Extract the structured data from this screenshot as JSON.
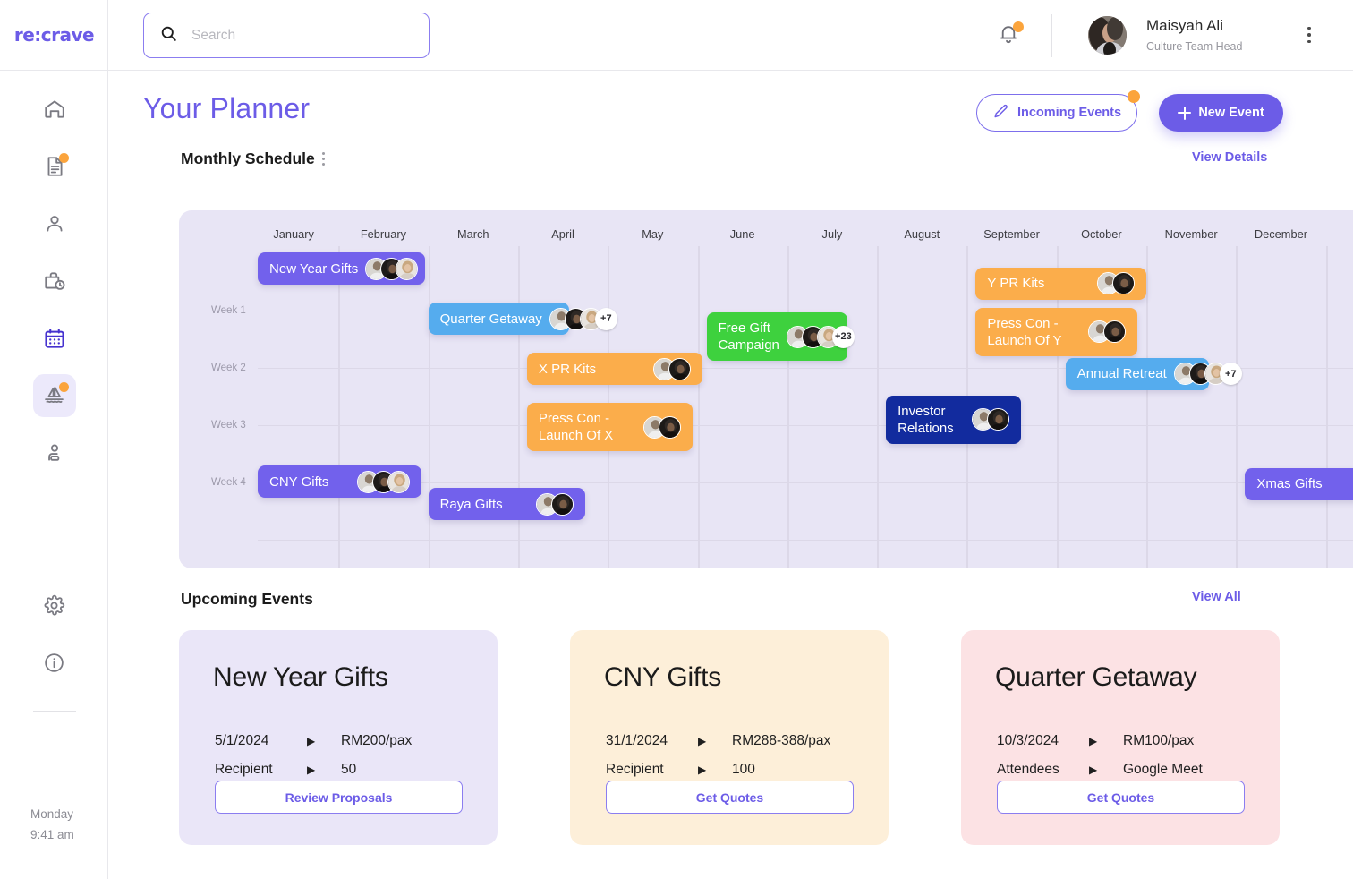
{
  "brand": {
    "logo_text": "re:crave"
  },
  "search": {
    "value": "",
    "placeholder": "Search"
  },
  "user": {
    "name": "Maisyah Ali",
    "role": "Culture Team Head"
  },
  "sidebar": {
    "items": [
      {
        "icon": "home-icon",
        "badge": false
      },
      {
        "icon": "document-icon",
        "badge": true
      },
      {
        "icon": "person-icon",
        "badge": false
      },
      {
        "icon": "briefcase-clock-icon",
        "badge": false
      },
      {
        "icon": "calendar-icon",
        "badge": false
      },
      {
        "icon": "sailboat-icon",
        "badge": true
      },
      {
        "icon": "person-desk-icon",
        "badge": false
      }
    ],
    "bottom": [
      {
        "icon": "gear-icon"
      },
      {
        "icon": "info-icon"
      }
    ],
    "clock": {
      "day": "Monday",
      "time": "9:41 am"
    }
  },
  "header": {
    "title": "Your Planner",
    "incoming_events_label": "Incoming Events",
    "new_event_label": "New Event"
  },
  "schedule": {
    "section_title": "Monthly Schedule",
    "view_details_label": "View Details"
  },
  "upcoming": {
    "section_title": "Upcoming Events",
    "view_all_label": "View All",
    "cards": [
      {
        "title": "New Year Gifts",
        "bg": "#EAE6F8",
        "rows": [
          {
            "key": "5/1/2024",
            "value": "RM200/pax"
          },
          {
            "key": "Recipient",
            "value": "50"
          }
        ],
        "action": "Review Proposals"
      },
      {
        "title": "CNY Gifts",
        "bg": "#FDEFD9",
        "rows": [
          {
            "key": "31/1/2024",
            "value": "RM288-388/pax"
          },
          {
            "key": "Recipient",
            "value": "100"
          }
        ],
        "action": "Get Quotes"
      },
      {
        "title": "Quarter Getaway",
        "bg": "#FCE2E4",
        "rows": [
          {
            "key": "10/3/2024",
            "value": "RM100/pax"
          },
          {
            "key": "Attendees",
            "value": "Google Meet"
          }
        ],
        "action": "Get Quotes"
      }
    ]
  },
  "chart_data": {
    "type": "table",
    "title": "Monthly Schedule",
    "xlabel": "",
    "ylabel": "",
    "grid": true,
    "categories": [
      "January",
      "February",
      "March",
      "April",
      "May",
      "June",
      "July",
      "August",
      "September",
      "October",
      "November",
      "December"
    ],
    "rows": [
      "Week 1",
      "Week 2",
      "Week 3",
      "Week 4"
    ],
    "colors": {
      "purple": "#6C5CE7",
      "blue": "#55ACEE",
      "orange": "#FBAD4B",
      "green": "#3ED13E",
      "navy": "#122B9E",
      "background": "#E8E5F5"
    },
    "events": [
      {
        "label": "New Year Gifts",
        "color": "#7261EC",
        "start_month": 0.1,
        "end_month": 1.96,
        "row": 0.0,
        "avatars": 3,
        "more": null
      },
      {
        "label": "Quarter Getaway",
        "color": "#55ACEE",
        "start_month": 2.0,
        "end_month": 3.57,
        "row": 1.0,
        "avatars": 3,
        "more": "+7"
      },
      {
        "label": "X PR Kits",
        "color": "#FBAD4B",
        "start_month": 3.1,
        "end_month": 5.05,
        "row": 2.0,
        "avatars": 2,
        "more": null
      },
      {
        "label": "Press Con -\nLaunch Of X",
        "color": "#FBAD4B",
        "start_month": 3.1,
        "end_month": 4.95,
        "row": 3.0,
        "avatars": 2,
        "more": null
      },
      {
        "label": "Free Gift\nCampaign",
        "color": "#3ED13E",
        "start_month": 5.1,
        "end_month": 6.67,
        "row": 1.2,
        "avatars": 3,
        "more": "+23"
      },
      {
        "label": "Investor\nRelations",
        "color": "#122B9E",
        "start_month": 7.1,
        "end_month": 8.6,
        "row": 2.85,
        "avatars": 2,
        "more": null
      },
      {
        "label": "Y PR Kits",
        "color": "#FBAD4B",
        "start_month": 8.1,
        "end_month": 10.0,
        "row": 0.3,
        "avatars": 2,
        "more": null
      },
      {
        "label": "Press Con -\nLaunch Of Y",
        "color": "#FBAD4B",
        "start_month": 8.1,
        "end_month": 9.9,
        "row": 1.1,
        "avatars": 2,
        "more": null
      },
      {
        "label": "Annual Retreat",
        "color": "#55ACEE",
        "start_month": 9.1,
        "end_month": 10.7,
        "row": 2.1,
        "avatars": 3,
        "more": "+7"
      },
      {
        "label": "CNY Gifts",
        "color": "#7261EC",
        "start_month": 0.1,
        "end_month": 1.92,
        "row": 4.25,
        "avatars": 3,
        "more": null
      },
      {
        "label": "Raya Gifts",
        "color": "#7261EC",
        "start_month": 2.0,
        "end_month": 3.75,
        "row": 4.7,
        "avatars": 2,
        "more": null
      },
      {
        "label": "Xmas Gifts",
        "color": "#7261EC",
        "start_month": 11.1,
        "end_month": 13.0,
        "row": 4.3,
        "avatars": 2,
        "more": null
      }
    ]
  }
}
